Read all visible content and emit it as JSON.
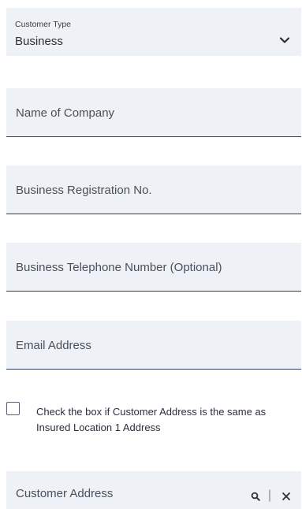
{
  "customer_type": {
    "label": "Customer Type",
    "value": "Business"
  },
  "fields": {
    "company_name": "Name of Company",
    "business_reg_no": "Business Registration No.",
    "business_phone": "Business Telephone Number (Optional)",
    "email": "Email Address"
  },
  "same_address_checkbox": {
    "label": "Check the box if Customer Address is the same as Insured Location 1 Address",
    "checked": false
  },
  "customer_address": {
    "placeholder": "Customer Address",
    "separator": "|",
    "icons": [
      "search-icon",
      "close-icon"
    ]
  },
  "colors": {
    "field_background": "#eef1f5",
    "underline": "#2e3d5e",
    "text": "#2b2f3a"
  }
}
